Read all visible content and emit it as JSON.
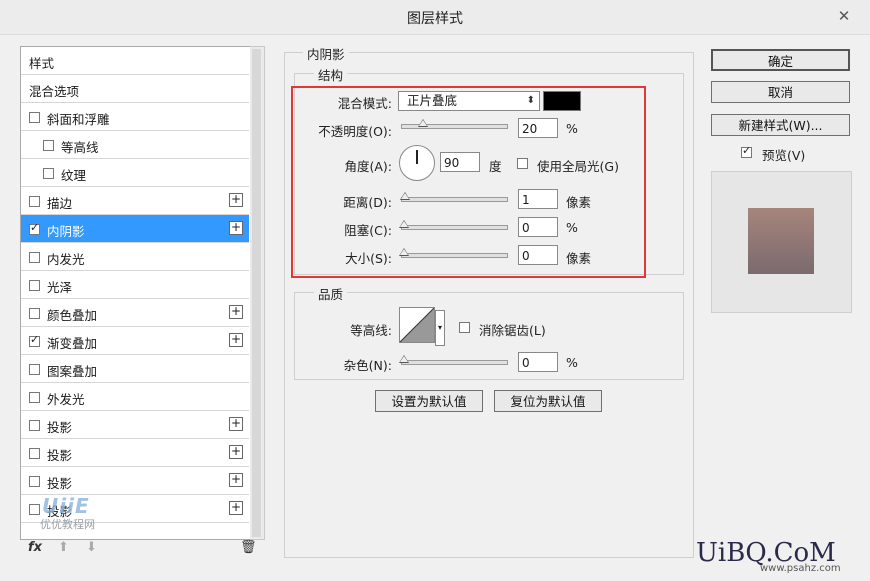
{
  "window": {
    "title": "图层样式",
    "close": "✕"
  },
  "style_list": [
    {
      "label": "样式",
      "checkbox": false,
      "plus": false,
      "indent": 0
    },
    {
      "label": "混合选项",
      "checkbox": false,
      "plus": false,
      "indent": 0
    },
    {
      "label": "斜面和浮雕",
      "checkbox": true,
      "checked": false,
      "plus": false,
      "indent": 0
    },
    {
      "label": "等高线",
      "checkbox": true,
      "checked": false,
      "plus": false,
      "indent": 1
    },
    {
      "label": "纹理",
      "checkbox": true,
      "checked": false,
      "plus": false,
      "indent": 1
    },
    {
      "label": "描边",
      "checkbox": true,
      "checked": false,
      "plus": true,
      "indent": 0
    },
    {
      "label": "内阴影",
      "checkbox": true,
      "checked": true,
      "plus": true,
      "indent": 0,
      "active": true
    },
    {
      "label": "内发光",
      "checkbox": true,
      "checked": false,
      "plus": false,
      "indent": 0
    },
    {
      "label": "光泽",
      "checkbox": true,
      "checked": false,
      "plus": false,
      "indent": 0
    },
    {
      "label": "颜色叠加",
      "checkbox": true,
      "checked": false,
      "plus": true,
      "indent": 0
    },
    {
      "label": "渐变叠加",
      "checkbox": true,
      "checked": true,
      "plus": true,
      "indent": 0
    },
    {
      "label": "图案叠加",
      "checkbox": true,
      "checked": false,
      "plus": false,
      "indent": 0
    },
    {
      "label": "外发光",
      "checkbox": true,
      "checked": false,
      "plus": false,
      "indent": 0
    },
    {
      "label": "投影",
      "checkbox": true,
      "checked": false,
      "plus": true,
      "indent": 0
    },
    {
      "label": "投影",
      "checkbox": true,
      "checked": false,
      "plus": true,
      "indent": 0
    },
    {
      "label": "投影",
      "checkbox": true,
      "checked": false,
      "plus": true,
      "indent": 0
    },
    {
      "label": "投影",
      "checkbox": true,
      "checked": false,
      "plus": true,
      "indent": 0
    }
  ],
  "bottom_bar": {
    "fx": "fx",
    "up": "⬆",
    "down": "⬇",
    "trash": "🗑"
  },
  "panel": {
    "title": "内阴影",
    "structure": {
      "title": "结构",
      "blend_mode_label": "混合模式:",
      "blend_mode_value": "正片叠底",
      "swatch_color": "#000000",
      "opacity_label": "不透明度(O):",
      "opacity_value": "20",
      "opacity_unit": "%",
      "opacity_level": 0.2,
      "angle_label": "角度(A):",
      "angle_value": "90",
      "angle_unit": "度",
      "global_light_label": "使用全局光(G)",
      "distance_label": "距离(D):",
      "distance_value": "1",
      "distance_unit": "像素",
      "choke_label": "阻塞(C):",
      "choke_value": "0",
      "choke_unit": "%",
      "size_label": "大小(S):",
      "size_value": "0",
      "size_unit": "像素"
    },
    "quality": {
      "title": "品质",
      "contour_label": "等高线:",
      "antialias_label": "消除锯齿(L)",
      "noise_label": "杂色(N):",
      "noise_value": "0",
      "noise_unit": "%"
    },
    "set_default": "设置为默认值",
    "reset_default": "复位为默认值"
  },
  "buttons": {
    "ok": "确定",
    "cancel": "取消",
    "new_style": "新建样式(W)...",
    "preview": "预览(V)"
  },
  "colors": {
    "accent": "#3399ff",
    "highlight_box": "#e0373b"
  },
  "watermarks": {
    "logo": "UiBQ.CoM",
    "site": "www.psahz.com",
    "brand": "UiiE",
    "brand_sub": "优优教程网"
  }
}
